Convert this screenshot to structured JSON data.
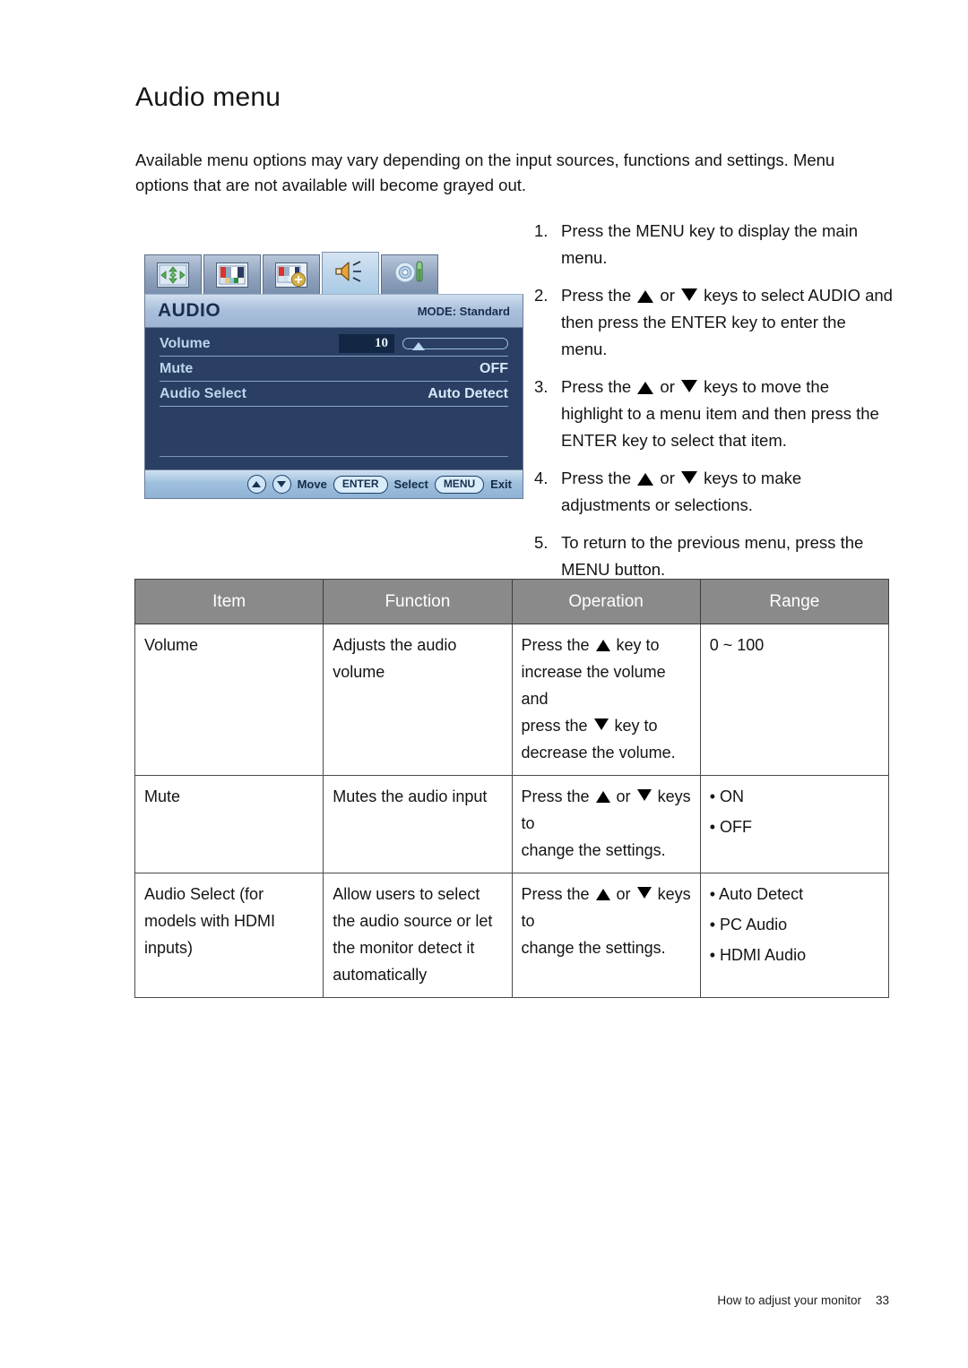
{
  "page": {
    "title": "Audio menu",
    "intro": "Available menu options may vary depending on the input sources, functions and settings. Menu options that are not available will become grayed out.",
    "footer_text": "How to adjust your monitor",
    "footer_page": "33"
  },
  "osd": {
    "tabs": [
      {
        "name": "display-tab",
        "icon": "arrows-move-icon"
      },
      {
        "name": "picture-tab",
        "icon": "color-bars-icon"
      },
      {
        "name": "picture-advanced-tab",
        "icon": "color-bars-plus-icon"
      },
      {
        "name": "audio-tab",
        "icon": "speaker-icon"
      },
      {
        "name": "system-tab",
        "icon": "gear-thermometer-icon"
      }
    ],
    "active_tab_index": 3,
    "title": "AUDIO",
    "mode": "MODE: Standard",
    "rows": [
      {
        "label": "Volume",
        "value": "10",
        "type": "slider",
        "slider_percent": 10
      },
      {
        "label": "Mute",
        "value": "OFF",
        "type": "text"
      },
      {
        "label": "Audio Select",
        "value": "Auto Detect",
        "type": "text"
      }
    ],
    "footer": {
      "move_label": "Move",
      "enter_label": "ENTER",
      "select_label": "Select",
      "menu_label": "MENU",
      "exit_label": "Exit"
    },
    "colors": {
      "body_bg": "#2a3f63",
      "title_bar": "#a9bfdb",
      "label_text": "#bcd5ec",
      "value_text": "#d7e8f7",
      "numbox_bg": "#122744"
    }
  },
  "steps": [
    {
      "num": "1.",
      "parts": [
        {
          "t": "text",
          "v": "Press the MENU key to display the main menu."
        }
      ]
    },
    {
      "num": "2.",
      "parts": [
        {
          "t": "text",
          "v": "Press the "
        },
        {
          "t": "icon",
          "v": "triangle-up-icon"
        },
        {
          "t": "text",
          "v": " or "
        },
        {
          "t": "icon",
          "v": "triangle-down-icon"
        },
        {
          "t": "text",
          "v": " keys to select AUDIO and then press the ENTER key to enter the menu."
        }
      ]
    },
    {
      "num": "3.",
      "parts": [
        {
          "t": "text",
          "v": "Press the "
        },
        {
          "t": "icon",
          "v": "triangle-up-icon"
        },
        {
          "t": "text",
          "v": " or "
        },
        {
          "t": "icon",
          "v": "triangle-down-icon"
        },
        {
          "t": "text",
          "v": " keys to move the highlight to a menu item and then press the ENTER key to select that item."
        }
      ]
    },
    {
      "num": "4.",
      "parts": [
        {
          "t": "text",
          "v": "Press the "
        },
        {
          "t": "icon",
          "v": "triangle-up-icon"
        },
        {
          "t": "text",
          "v": " or "
        },
        {
          "t": "icon",
          "v": "triangle-down-icon"
        },
        {
          "t": "text",
          "v": " keys to make adjustments or selections."
        }
      ]
    },
    {
      "num": "5.",
      "parts": [
        {
          "t": "text",
          "v": "To return to the previous menu, press the MENU button."
        }
      ]
    }
  ],
  "table": {
    "headers": [
      "Item",
      "Function",
      "Operation",
      "Range"
    ],
    "rows": [
      {
        "item": "Volume",
        "function": "Adjusts the audio volume",
        "operation_lines": [
          {
            "pre": "Press the ",
            "icon": "triangle-up-icon",
            "post": " key to"
          },
          {
            "pre": "increase the volume and",
            "icon": null,
            "post": ""
          },
          {
            "pre": "press the ",
            "icon": "triangle-down-icon",
            "post": " key to"
          },
          {
            "pre": "decrease the volume.",
            "icon": null,
            "post": ""
          }
        ],
        "range": [
          "0 ~ 100"
        ]
      },
      {
        "item": "Mute",
        "function": "Mutes the audio input",
        "operation_lines": [
          {
            "pre": "Press the ",
            "icon": "triangle-up-icon",
            "mid": " or ",
            "icon2": "triangle-down-icon",
            "post": " keys to"
          },
          {
            "pre": "change the settings.",
            "icon": null,
            "post": ""
          }
        ],
        "range": [
          "• ON",
          "• OFF"
        ]
      },
      {
        "item": "Audio Select (for models with HDMI inputs)",
        "function": "Allow users to select the audio source or let the monitor detect it automatically",
        "operation_lines": [
          {
            "pre": "Press the ",
            "icon": "triangle-up-icon",
            "mid": " or ",
            "icon2": "triangle-down-icon",
            "post": " keys to"
          },
          {
            "pre": "change the settings.",
            "icon": null,
            "post": ""
          }
        ],
        "range": [
          "• Auto Detect",
          "• PC Audio",
          "• HDMI Audio"
        ]
      }
    ]
  }
}
